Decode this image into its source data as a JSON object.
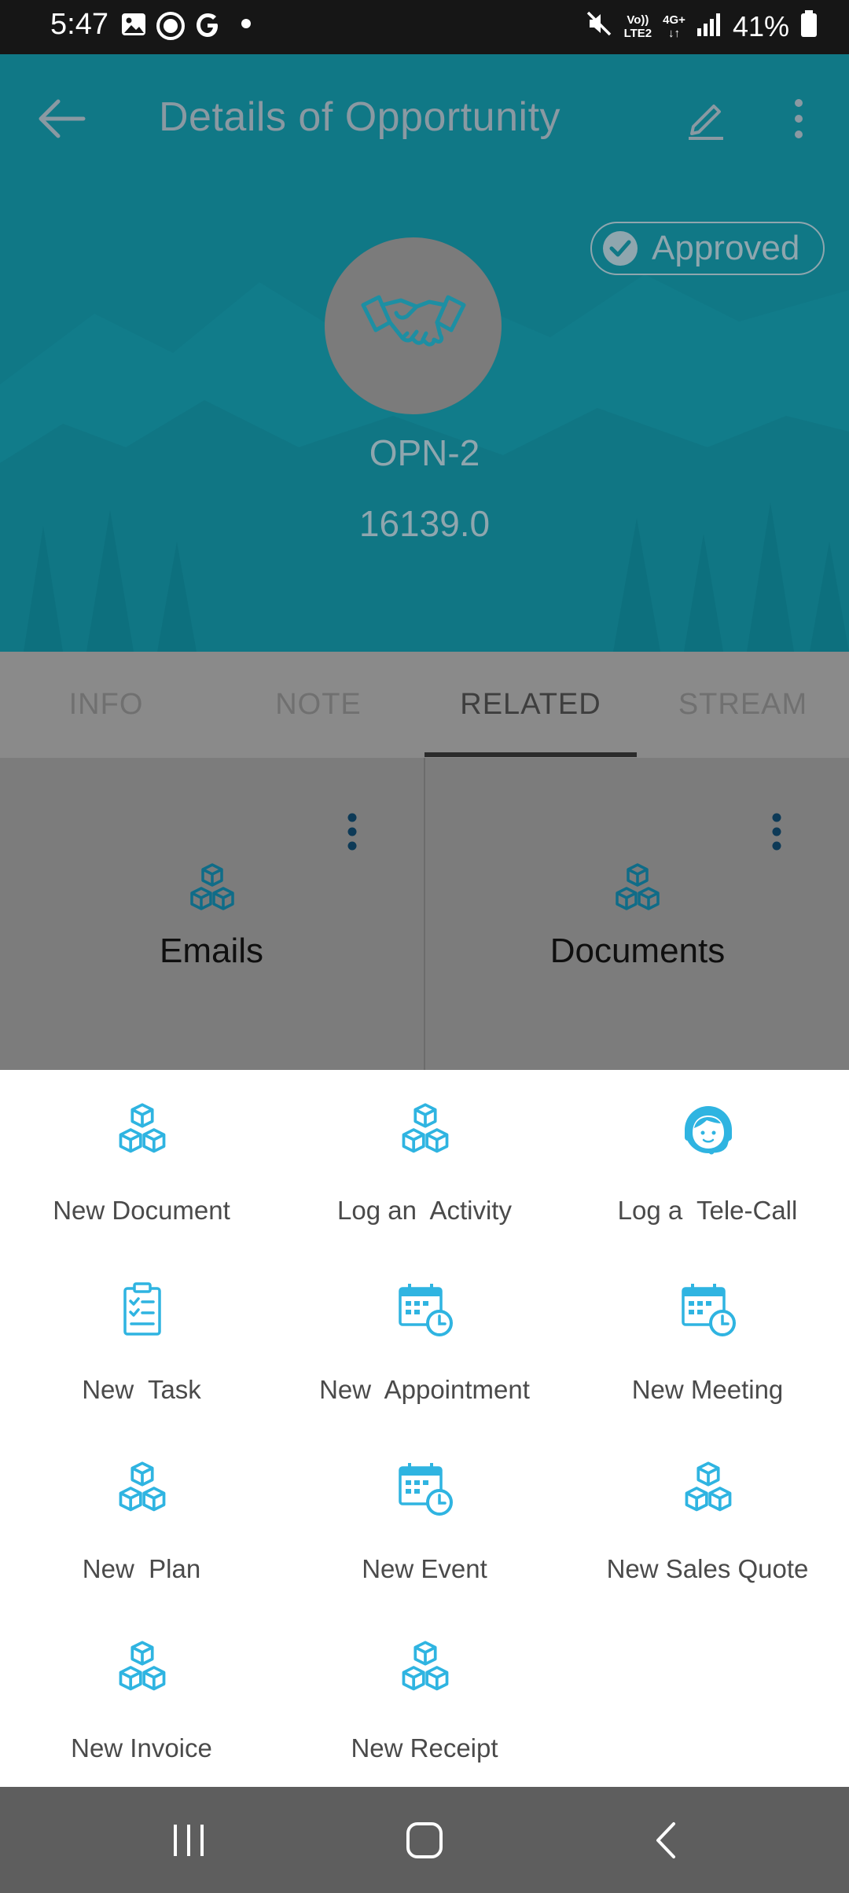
{
  "status_bar": {
    "time": "5:47",
    "network_top": "Vo))",
    "network_bottom": "LTE2",
    "net_type": "4G+",
    "battery": "41%"
  },
  "header": {
    "title": "Details of Opportunity",
    "badge": "Approved",
    "opportunity_id": "OPN-2",
    "opportunity_value": "16139.0"
  },
  "tabs": [
    {
      "label": "INFO"
    },
    {
      "label": "NOTE"
    },
    {
      "label": "RELATED"
    },
    {
      "label": "STREAM"
    }
  ],
  "active_tab": "RELATED",
  "cards": [
    {
      "label": "Emails",
      "icon": "cubes-icon"
    },
    {
      "label": "Documents",
      "icon": "cubes-icon"
    }
  ],
  "actions": [
    {
      "label": "New Document",
      "icon": "cubes-icon"
    },
    {
      "label": "Log an  Activity",
      "icon": "cubes-icon"
    },
    {
      "label": "Log a  Tele-Call",
      "icon": "headset-agent-icon"
    },
    {
      "label": "New  Task",
      "icon": "clipboard-checklist-icon"
    },
    {
      "label": "New  Appointment",
      "icon": "calendar-clock-icon"
    },
    {
      "label": "New Meeting",
      "icon": "calendar-clock-icon"
    },
    {
      "label": "New  Plan",
      "icon": "cubes-icon"
    },
    {
      "label": "New Event",
      "icon": "calendar-clock-icon"
    },
    {
      "label": "New Sales Quote",
      "icon": "cubes-icon"
    },
    {
      "label": "New Invoice",
      "icon": "cubes-icon"
    },
    {
      "label": "New Receipt",
      "icon": "cubes-icon"
    }
  ],
  "colors": {
    "header_bg": "#107886",
    "accent_icon": "#2fb4e1",
    "card_icon": "#0f6c88",
    "overlay_text": "#8fa6ae"
  }
}
